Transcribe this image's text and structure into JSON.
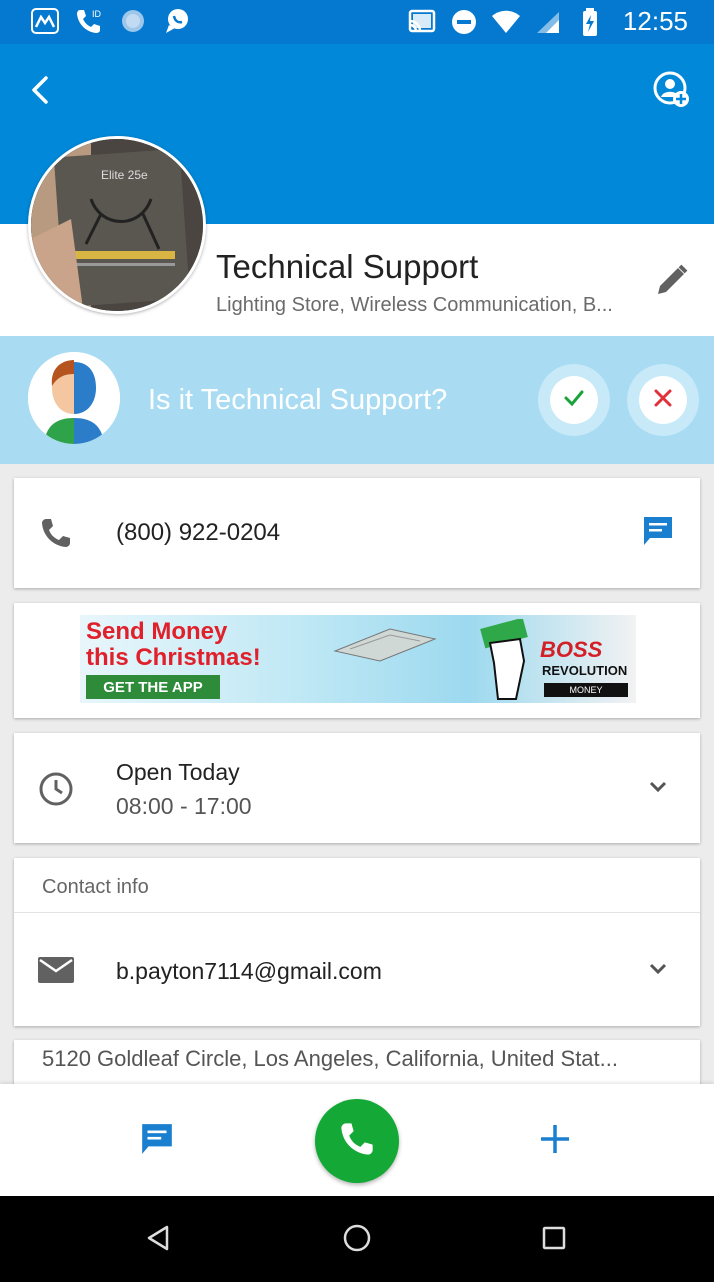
{
  "status_bar": {
    "time": "12:55",
    "left_icons": [
      "monitor-app-icon",
      "wifi-call-icon",
      "circle-dot-icon",
      "chat-bubble-icon"
    ],
    "right_icons": [
      "cast-icon",
      "dnd-icon",
      "wifi-icon",
      "signal-icon",
      "battery-icon"
    ]
  },
  "header": {
    "name": "Technical Support",
    "category": "Lighting Store, Wireless Communication, B...",
    "photo_text": "Elite 25e"
  },
  "confirm": {
    "question": "Is it Technical Support?"
  },
  "phone": {
    "number": "(800) 922-0204"
  },
  "ad": {
    "line1": "Send Money",
    "line2": "this Christmas!",
    "cta": "GET THE APP",
    "brand1": "BOSS",
    "brand2": "REVOLUTION",
    "brand3": "MONEY"
  },
  "hours": {
    "status": "Open Today",
    "time": "08:00 - 17:00"
  },
  "contact": {
    "header": "Contact info",
    "email": "b.payton7114@gmail.com"
  },
  "address": {
    "text": "5120 Goldleaf Circle, Los Angeles, California, United Stat..."
  },
  "colors": {
    "primary": "#0288d8",
    "confirm_bar": "#a9dcf3",
    "call_green": "#14a836",
    "accent_blue": "#1a7fcf"
  }
}
